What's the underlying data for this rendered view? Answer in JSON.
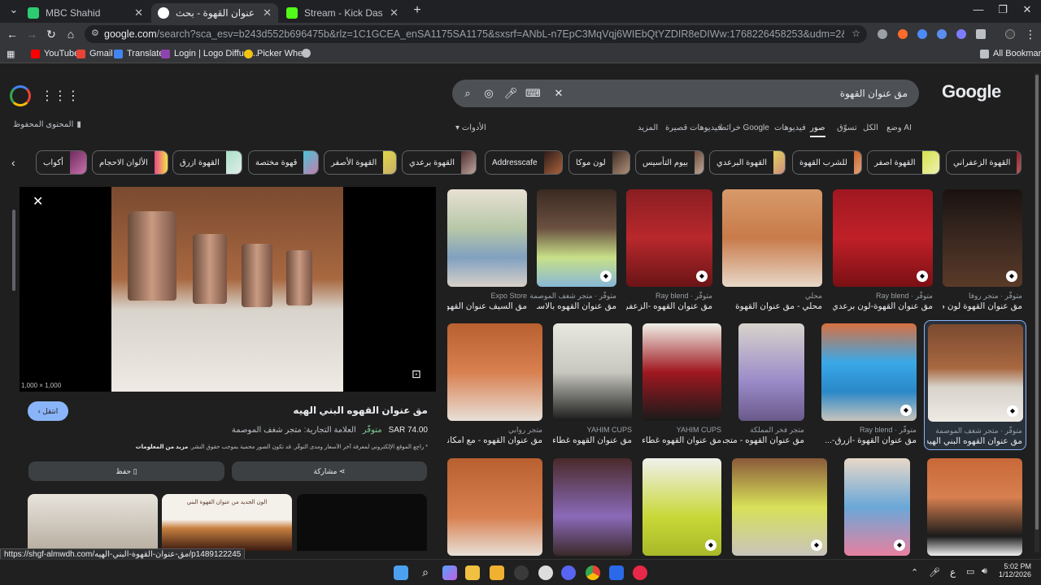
{
  "browser": {
    "tabs": [
      {
        "title": "MBC Shahid",
        "active": false
      },
      {
        "title": "مق عنوان القهوة - بحث Google",
        "active": true
      },
      {
        "title": "Stream - Kick Dashboard",
        "active": false
      }
    ],
    "new_tab": "+",
    "url_main": "google.com",
    "url_rest": "/search?sca_esv=b243d552b696475b&rlz=1C1GCEA_enSA1175SA1175&sxsrf=ANbL-n7EpC3MqVqj6WIEbQtYZDIR8eDIWw:1768226458253&udm=2&fbs=ADc_l-aoAnkLcbTr92phrBPsEtBzdc4k6pvHyiHE7W-6e...",
    "bookmarks": [
      "YouTube",
      "Gmail",
      "Translate",
      "Login | Logo Diffusi...",
      "Picker Wheel"
    ],
    "all_bookmarks": "All Bookmarks"
  },
  "search": {
    "logo": "Google",
    "query": "مق عنوان القهوة",
    "nav_tabs": [
      "وضع AI",
      "الكل",
      "تسوّق",
      "صور",
      "فيديوهات",
      "خرائط Google",
      "فيديوهات قصيرة",
      "المزيد"
    ],
    "tools": "الأدوات",
    "saved": "المحتوى المحفوظ",
    "chips": [
      "القهوة الزعفراني",
      "القهوة اصفر",
      "للشرب القهوة",
      "القهوة البرعدي",
      "بيوم التأسيس",
      "لون موكا",
      "Addresscafe",
      "القهوة برعدي",
      "القهوة الأصفر",
      "قهوة مختصة",
      "القهوة ازرق",
      "الألوان الاحجام",
      "أكواب"
    ]
  },
  "preview": {
    "size": "1,000 × 1,000",
    "title": "مق عنوان القهوه البني الهيه",
    "price": "SAR 74.00",
    "stock": "متوفّر",
    "brand": "العلامة التجارية: متجر شغف الموصمة",
    "disclaimer": "* راجِع الموقع الإلكتروني لمعرفة آخر الأسعار ومدى التوفّر. قد تكون الصور محمية بموجب حقوق النشر.",
    "more_info": "مزيد من المعلومات",
    "visit": "انتقل",
    "share": "مشاركة",
    "save": "حفظ",
    "related_text": "الون الجديد من عنوان القهوة البني"
  },
  "grid": [
    [
      {
        "src": "Expo Store",
        "cap": "مق السيف عنوان القهو..."
      },
      {
        "src": "متوفّر · متجر شغف الموصمة",
        "cap": "مق عنوان القهوه بالاسم..."
      },
      {
        "src": "متوفّر · Ray blend",
        "cap": "مق عنوان القهوه -الزعفرا..."
      },
      {
        "src": "محلي",
        "cap": "محلي - مق عنوان القهوة"
      },
      {
        "src": "متوفّر · Ray blend",
        "cap": "مق عنوان القهوة-لون برعدي"
      },
      {
        "src": "متوفّر · متجر روفا",
        "cap": "مق عنوان القهوة لون م..."
      }
    ],
    [
      {
        "src": "متجر روابي",
        "cap": "مق عنوان القهوه - مع امكانية..."
      },
      {
        "src": "YAHIM CUPS",
        "cap": "مق عنوان القهوه غطاء..."
      },
      {
        "src": "YAHIM CUPS",
        "cap": "مق عنوان القهوه غطاء..."
      },
      {
        "src": "متجر فخر المملكة",
        "cap": "مق عنوان القهوه - متجر..."
      },
      {
        "src": "متوفّر · Ray blend",
        "cap": "مق عنوان القهوة -ازرق-..."
      },
      {
        "src": "متوفّر · متجر شغف الموصمة",
        "cap": "مق عنوان القهوه البني الهيه -..."
      }
    ],
    [
      {
        "src": "",
        "cap": ""
      },
      {
        "src": "",
        "cap": ""
      },
      {
        "src": "",
        "cap": ""
      },
      {
        "src": "",
        "cap": ""
      },
      {
        "src": "",
        "cap": ""
      },
      {
        "src": "",
        "cap": ""
      }
    ]
  ],
  "status_url": "https://shgf-almwdh.com/مق-عنوان-القهوة-البني-الهيه/p1489122245",
  "taskbar": {
    "time": "5:02 PM",
    "date": "1/12/2026",
    "lang": "ع"
  },
  "colors": {
    "accent": "#8ab4f8",
    "active_tab": "#35363a",
    "page_bg": "#1f1f1f",
    "searchbox": "#4d5156"
  }
}
